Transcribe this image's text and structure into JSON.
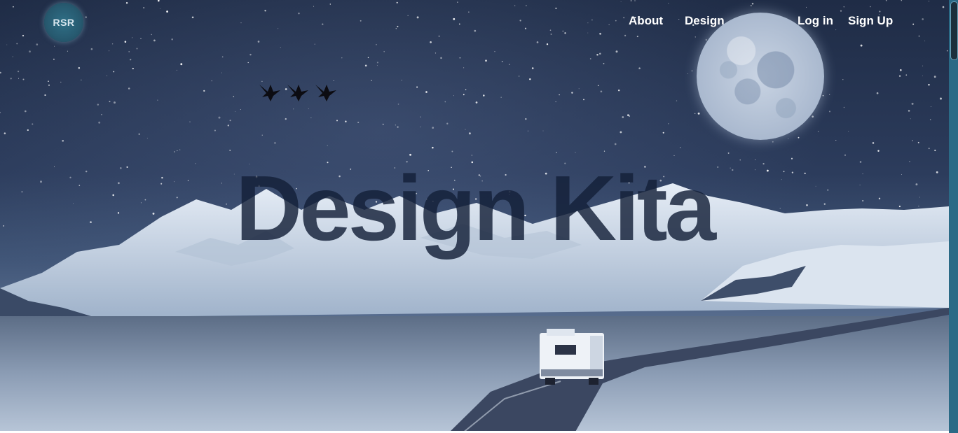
{
  "brand": {
    "logo_text": "RSR"
  },
  "nav": {
    "about": "About",
    "design": "Design",
    "login": "Log in",
    "signup": "Sign Up"
  },
  "hero": {
    "title": "Design Kita"
  },
  "icons": [
    "bird-icon",
    "bird-icon",
    "bird-icon",
    "moon",
    "camper-van"
  ],
  "colors": {
    "sky_top": "#1f2c46",
    "title": "#142038",
    "logo_bg": "#2f6f86",
    "scrollbar": "#2a6a86"
  }
}
